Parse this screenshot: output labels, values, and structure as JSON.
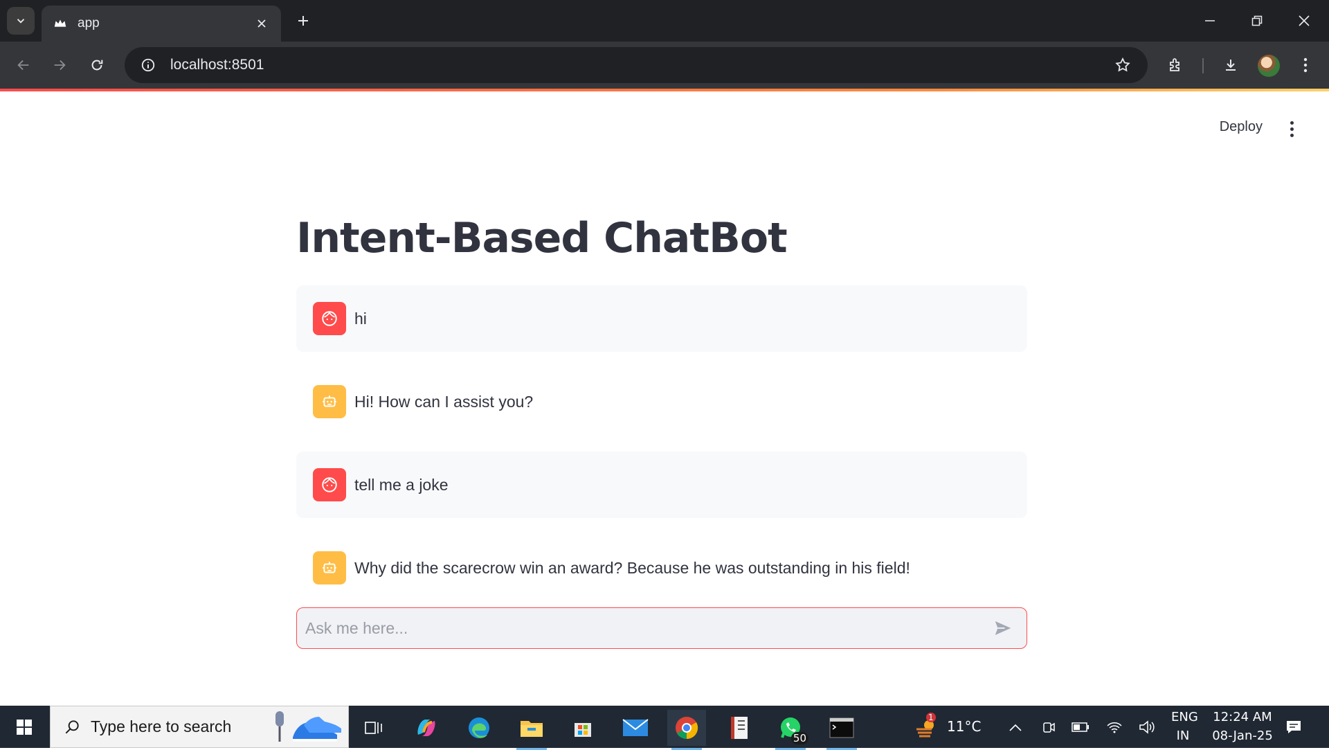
{
  "browser": {
    "tab_title": "app",
    "url": "localhost:8501"
  },
  "app": {
    "deploy_label": "Deploy",
    "title": "Intent-Based ChatBot",
    "messages": [
      {
        "role": "user",
        "text": "hi"
      },
      {
        "role": "assistant",
        "text": "Hi! How can I assist you?"
      },
      {
        "role": "user",
        "text": "tell me a joke"
      },
      {
        "role": "assistant",
        "text": "Why did the scarecrow win an award? Because he was outstanding in his field!"
      }
    ],
    "chat_input": {
      "placeholder": "Ask me here...",
      "value": ""
    },
    "colors": {
      "user_avatar": "#ff4b4b",
      "assistant_avatar": "#ffbd45",
      "accent": "#ff4b4b"
    }
  },
  "taskbar": {
    "search_placeholder": "Type here to search",
    "whatsapp_badge": "50",
    "weather_alert_count": "1",
    "temperature": "11°C",
    "language": "ENG",
    "region": "IN",
    "time": "12:24 AM",
    "date": "08-Jan-25"
  }
}
